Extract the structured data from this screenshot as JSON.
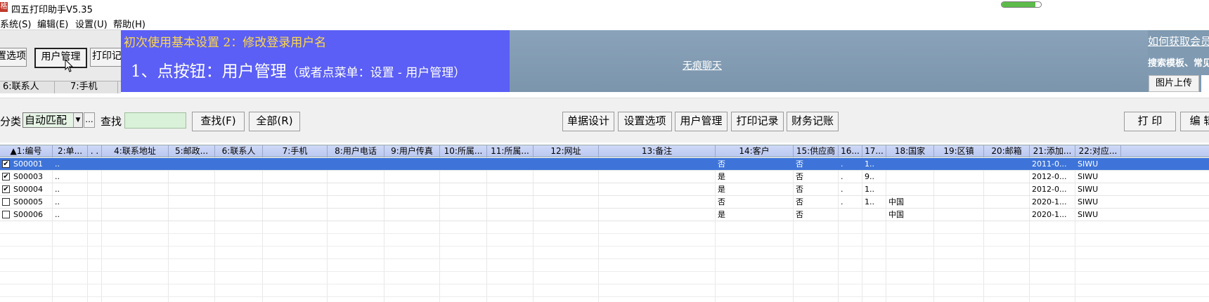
{
  "window": {
    "title": "四五打印助手V5.35",
    "icon_text": "格",
    "progress": 0.85
  },
  "menu": [
    "系统(S)",
    "编辑(E)",
    "设置(U)",
    "帮助(H)"
  ],
  "toolbar": {
    "buttons": [
      "置选项",
      "用户管理",
      "打印记"
    ]
  },
  "column_tabs": [
    "6:联系人",
    "7:手机"
  ],
  "banner": {
    "subtitle": "初次使用基本设置 2：修改登录用户名",
    "main": "1、点按钮：用户管理",
    "main_note": "（或者点菜单：设置 - 用户管理）",
    "chat_link": "无痕聊天"
  },
  "right_panel": {
    "member_link": "如何获取会员II",
    "search_text": "搜索模板、常见",
    "upload_tab": "图片上传"
  },
  "filter": {
    "category_label": "分类",
    "category_value": "自动匹配",
    "ellipsis": "...",
    "search_label": "查找",
    "search_value": "",
    "find_button": "查找(F)",
    "all_button": "全部(R)",
    "actions": [
      "单据设计",
      "设置选项",
      "用户管理",
      "打印记录",
      "财务记账"
    ],
    "print_button": "打 印",
    "edit_button": "编 辑"
  },
  "table": {
    "columns": [
      "▲1:编号",
      "2:单...",
      ". .",
      "4:联系地址",
      "5:邮政...",
      "6:联系人",
      "7:手机",
      "8:用户电话",
      "9:用户传真",
      "10:所属...",
      "11:所属...",
      "12:网址",
      "13:备注",
      "14:客户",
      "15:供应商",
      "16...",
      "17...",
      "18:国家",
      "19:区镇",
      "20:邮箱",
      "21:添加...",
      "22:对应..."
    ],
    "rows": [
      {
        "checked": true,
        "selected": true,
        "cells": [
          "S00001",
          "..",
          "",
          "",
          "",
          "",
          "",
          "",
          "",
          "",
          "",
          "",
          "",
          "否",
          "否",
          ".",
          "1..",
          "",
          "",
          "",
          "2011-0...",
          "SIWU"
        ]
      },
      {
        "checked": true,
        "selected": false,
        "cells": [
          "S00003",
          "..",
          "",
          "",
          "",
          "",
          "",
          "",
          "",
          "",
          "",
          "",
          "",
          "是",
          "否",
          ".",
          "9..",
          "",
          "",
          "",
          "2012-0...",
          "SIWU"
        ]
      },
      {
        "checked": true,
        "selected": false,
        "cells": [
          "S00004",
          "..",
          "",
          "",
          "",
          "",
          "",
          "",
          "",
          "",
          "",
          "",
          "",
          "是",
          "否",
          ".",
          "1..",
          "",
          "",
          "",
          "2012-0...",
          "SIWU"
        ]
      },
      {
        "checked": false,
        "selected": false,
        "cells": [
          "S00005",
          "..",
          "",
          "",
          "",
          "",
          "",
          "",
          "",
          "",
          "",
          "",
          "",
          "否",
          "否",
          ".",
          "1..",
          "中国",
          "",
          "",
          "2020-1...",
          "SIWU"
        ]
      },
      {
        "checked": false,
        "selected": false,
        "cells": [
          "S00006",
          "..",
          "",
          "",
          "",
          "",
          "",
          "",
          "",
          "",
          "",
          "",
          "",
          "是",
          "否",
          "",
          "",
          "中国",
          "",
          "",
          "2020-1...",
          "SIWU"
        ]
      }
    ]
  }
}
